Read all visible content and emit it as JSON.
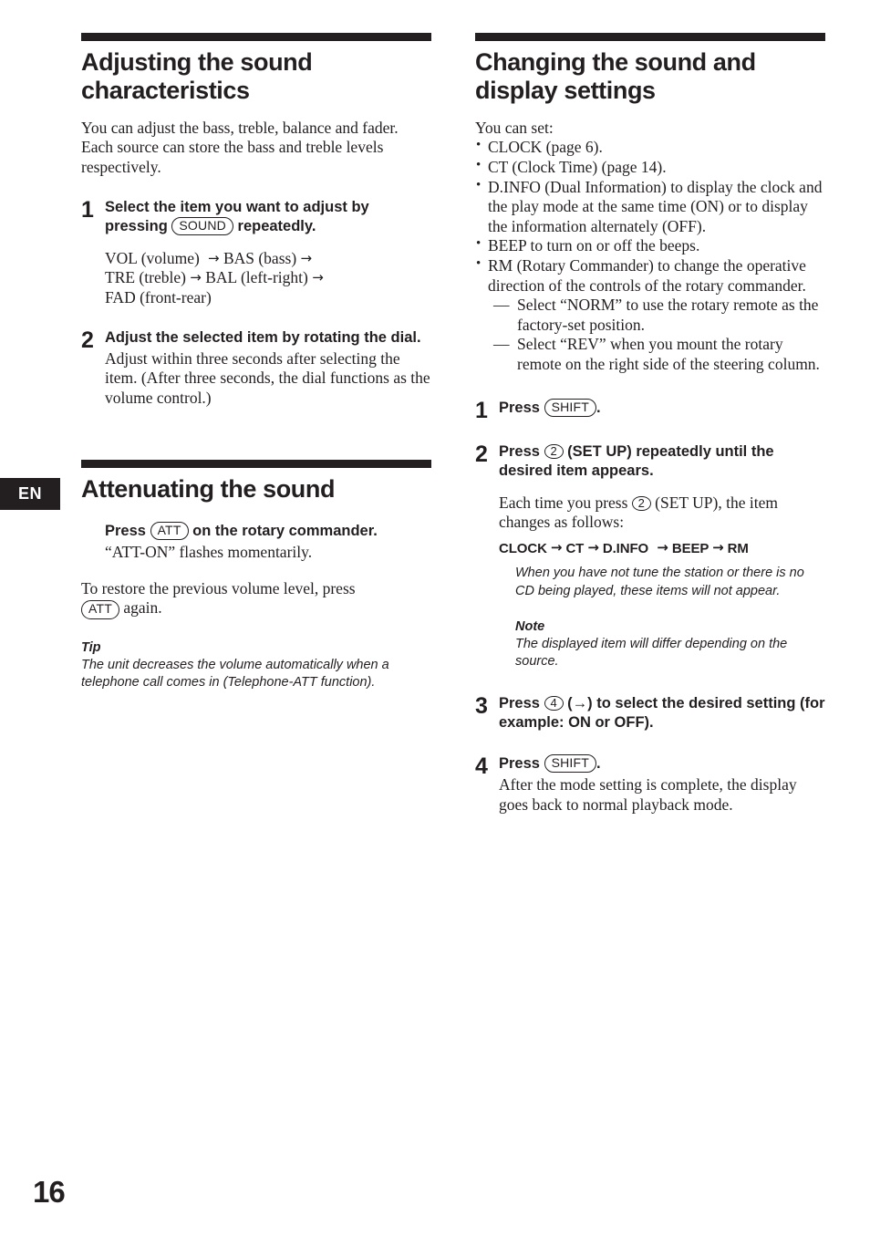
{
  "page": {
    "language_tab": "EN",
    "folio": "16"
  },
  "left_column": {
    "section1": {
      "title": "Adjusting the sound characteristics",
      "intro": "You can adjust the bass, treble, balance and fader.\nEach source can store the bass and treble levels respectively.",
      "steps": [
        {
          "number": "1",
          "head_before_key": "Select the item you want to adjust by pressing",
          "key": "SOUND",
          "head_after_key": "repeatedly.",
          "flow_line1_a": "VOL (volume)",
          "flow_line1_b": "BAS (bass)",
          "flow_line2_a": "TRE (treble)",
          "flow_line2_b": "BAL (left-right)",
          "flow_line3": "FAD (front-rear)"
        },
        {
          "number": "2",
          "head": "Adjust the selected item by rotating the dial.",
          "sub": "Adjust within three seconds after selecting the item. (After three seconds, the dial functions as the volume control.)"
        }
      ]
    },
    "section2": {
      "title": "Attenuating the sound",
      "press_before_key": "Press",
      "press_key": "ATT",
      "press_after_key": "on the rotary commander.",
      "press_sub": "“ATT-ON” flashes momentarily.",
      "restore_before_key": "To restore the previous volume level, press",
      "restore_key": "ATT",
      "restore_after_key": "again.",
      "tip_title": "Tip",
      "tip_body": "The unit decreases the volume automatically when a telephone call comes in (Telephone-ATT function)."
    }
  },
  "right_column": {
    "section1": {
      "title": "Changing the sound and display settings",
      "intro": "You can set:",
      "bullets": [
        "CLOCK (page 6).",
        "CT (Clock Time) (page 14).",
        "D.INFO (Dual Information) to display the clock and the play mode at the same time (ON) or to display the information alternately (OFF).",
        "BEEP to turn on or off the beeps.",
        "RM (Rotary Commander) to change the operative direction of the controls of the rotary commander."
      ],
      "dash_items": [
        "Select “NORM” to use the rotary remote as the factory-set position.",
        "Select “REV” when you mount the rotary remote on the right side of the steering column."
      ],
      "steps": [
        {
          "number": "1",
          "press_label": "Press",
          "key": "SHIFT",
          "trailing": "."
        },
        {
          "number": "2",
          "press_label": "Press",
          "keynum": "2",
          "head_after_key": "(SET UP) repeatedly until the desired item appears.",
          "body_before_key": "Each time you press",
          "body_keynum": "2",
          "body_after_key": "(SET UP), the item changes as follows:",
          "flow": [
            "CLOCK",
            "CT",
            "D.INFO",
            "BEEP",
            "RM"
          ],
          "flow_note": "When you have not tune the station or there is no CD being played, these items will not appear.",
          "note_title": "Note",
          "note_body": "The displayed item will differ depending on the source."
        },
        {
          "number": "3",
          "press_label": "Press",
          "keynum": "4",
          "head_after_key": "(→) to select the desired setting (for example: ON or OFF)."
        },
        {
          "number": "4",
          "press_label": "Press",
          "key": "SHIFT",
          "trailing": ".",
          "sub": "After the mode setting is complete, the display goes back to normal playback mode."
        }
      ]
    }
  },
  "icons": {
    "arrow_right": "→",
    "bullet": "•",
    "em_dash": "—"
  }
}
